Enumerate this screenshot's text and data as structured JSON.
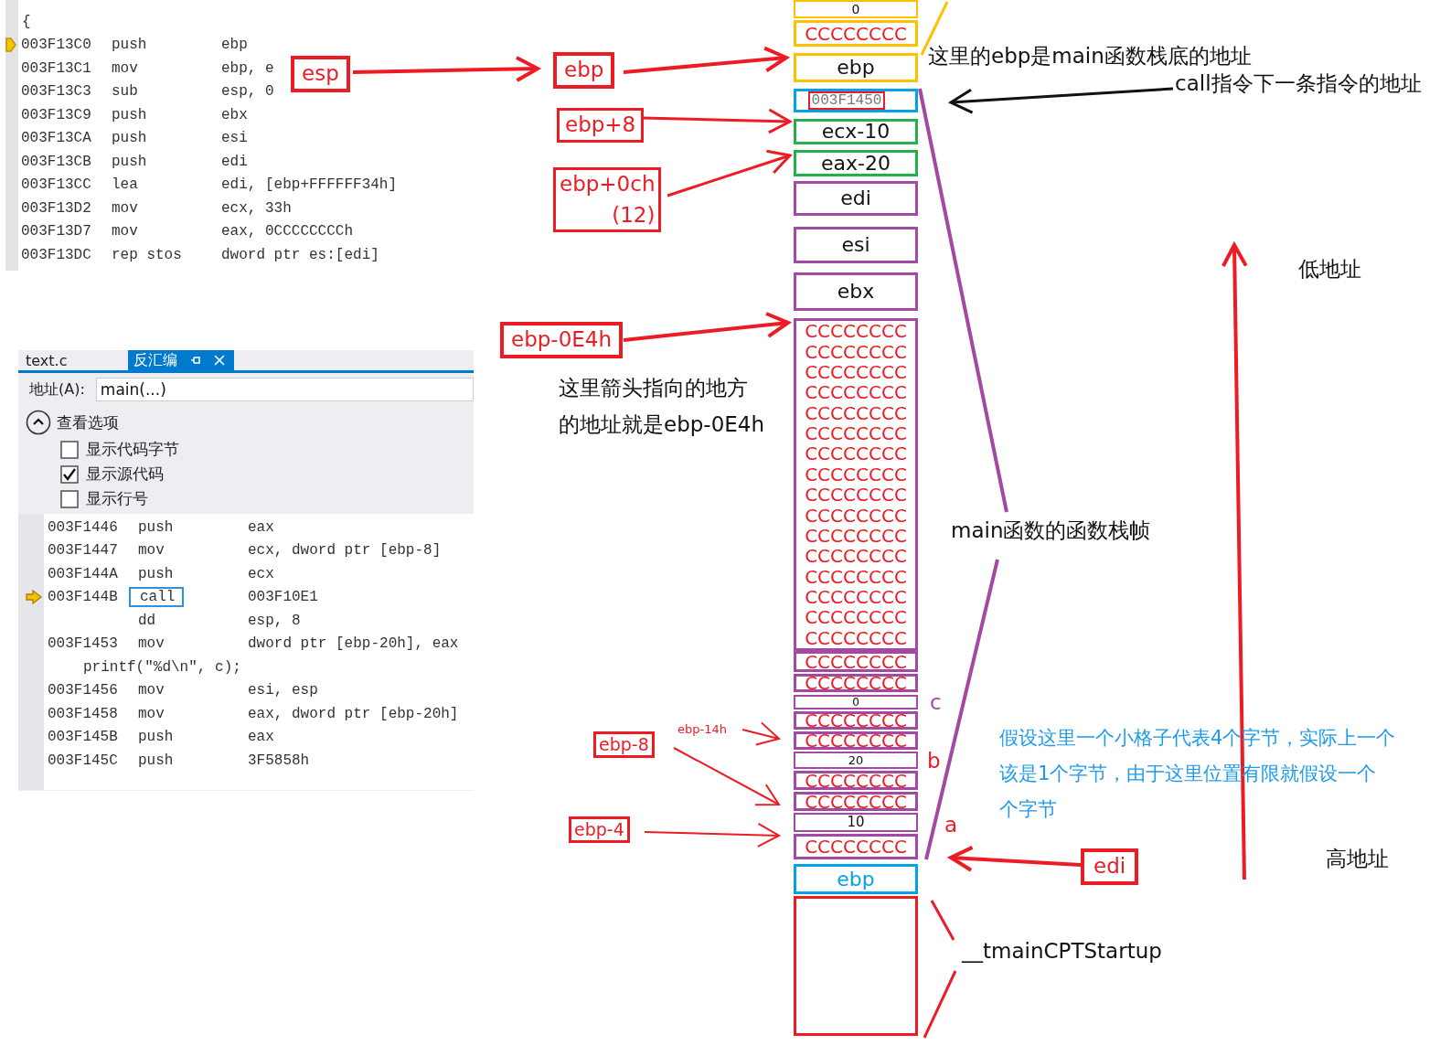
{
  "top_code": {
    "brace": "{",
    "lines": [
      {
        "addr": "003F13C0",
        "op": "push",
        "arg": "ebp",
        "current": true
      },
      {
        "addr": "003F13C1",
        "op": "mov",
        "arg": "ebp, e",
        "current": false
      },
      {
        "addr": "003F13C3",
        "op": "sub",
        "arg": "esp, 0",
        "current": false
      },
      {
        "addr": "003F13C9",
        "op": "push",
        "arg": "ebx",
        "current": false
      },
      {
        "addr": "003F13CA",
        "op": "push",
        "arg": "esi",
        "current": false
      },
      {
        "addr": "003F13CB",
        "op": "push",
        "arg": "edi",
        "current": false
      },
      {
        "addr": "003F13CC",
        "op": "lea",
        "arg": "edi, [ebp+FFFFFF34h]",
        "current": false
      },
      {
        "addr": "003F13D2",
        "op": "mov",
        "arg": "ecx, 33h",
        "current": false
      },
      {
        "addr": "003F13D7",
        "op": "mov",
        "arg": "eax, 0CCCCCCCCh",
        "current": false
      },
      {
        "addr": "003F13DC",
        "op": "rep stos",
        "arg": "dword ptr es:[edi]",
        "current": false
      }
    ]
  },
  "disassembly_panel": {
    "tabs": [
      {
        "label": "text.c",
        "selected": false
      },
      {
        "label": "反汇编",
        "selected": true
      }
    ],
    "address": {
      "label": "地址(A):",
      "value": "main(...)"
    },
    "view_options": {
      "title": "查看选项",
      "expanded": true,
      "options": [
        {
          "label": "显示代码字节",
          "checked": false
        },
        {
          "label": "显示源代码",
          "checked": true
        },
        {
          "label": "显示行号",
          "checked": false
        }
      ]
    },
    "lines": [
      {
        "kind": "instruction",
        "addr": "003F1446",
        "op": "push",
        "arg": "eax",
        "current": false,
        "boxed": false
      },
      {
        "kind": "instruction",
        "addr": "003F1447",
        "op": "mov",
        "arg": "ecx, dword ptr [ebp-8]",
        "current": false,
        "boxed": false
      },
      {
        "kind": "instruction",
        "addr": "003F144A",
        "op": "push",
        "arg": "ecx",
        "current": false,
        "boxed": false
      },
      {
        "kind": "instruction",
        "addr": "003F144B",
        "op": "call",
        "arg": "003F10E1",
        "current": true,
        "boxed": true
      },
      {
        "kind": "instruction",
        "op": "dd",
        "arg": "esp, 8",
        "current": false,
        "boxed": false
      },
      {
        "kind": "instruction",
        "addr": "003F1453",
        "op": "mov",
        "arg": "dword ptr [ebp-20h], eax",
        "current": false,
        "boxed": false
      },
      {
        "kind": "source",
        "text": "printf(\"%d\\n\", c);"
      },
      {
        "kind": "instruction",
        "addr": "003F1456",
        "op": "mov",
        "arg": "esi, esp",
        "current": false,
        "boxed": false
      },
      {
        "kind": "instruction",
        "addr": "003F1458",
        "op": "mov",
        "arg": "eax, dword ptr [ebp-20h]",
        "current": false,
        "boxed": false
      },
      {
        "kind": "instruction",
        "addr": "003F145B",
        "op": "push",
        "arg": "eax",
        "current": false,
        "boxed": false
      },
      {
        "kind": "instruction",
        "addr": "003F145C",
        "op": "push",
        "arg": "3F5858h",
        "current": false,
        "boxed": false
      }
    ]
  },
  "stack": [
    {
      "kind": "value",
      "text": "0",
      "color": "#ffc000"
    },
    {
      "kind": "fill",
      "text": "CCCCCCCC",
      "color": "#ffc000"
    },
    {
      "kind": "value",
      "text": "ebp",
      "color": "#ffc000"
    },
    {
      "kind": "address",
      "text": "003F1450",
      "color": "#00a2e8"
    },
    {
      "kind": "value",
      "text": "ecx-10",
      "color": "#22b14c"
    },
    {
      "kind": "value",
      "text": "eax-20",
      "color": "#22b14c"
    },
    {
      "kind": "value",
      "text": "edi",
      "color": "#a349a4"
    },
    {
      "kind": "value",
      "text": "esi",
      "color": "#a349a4"
    },
    {
      "kind": "value",
      "text": "ebx",
      "color": "#a349a4"
    },
    {
      "kind": "block",
      "color": "#a349a4",
      "lines": [
        "CCCCCCCC",
        "CCCCCCCC",
        "CCCCCCCC",
        "CCCCCCCC",
        "CCCCCCCC",
        "CCCCCCCC",
        "CCCCCCCC",
        "CCCCCCCC",
        "CCCCCCCC",
        "CCCCCCCC",
        "CCCCCCCC",
        "CCCCCCCC",
        "CCCCCCCC",
        "CCCCCCCC",
        "CCCCCCCC",
        "CCCCCCCC"
      ]
    },
    {
      "kind": "fill",
      "text": "CCCCCCCC",
      "color": "#a349a4"
    },
    {
      "kind": "fill",
      "text": "CCCCCCCC",
      "color": "#a349a4"
    },
    {
      "kind": "value",
      "text": "0",
      "color": "#a349a4"
    },
    {
      "kind": "fill",
      "text": "CCCCCCCC",
      "color": "#a349a4"
    },
    {
      "kind": "fill",
      "text": "CCCCCCCC",
      "color": "#a349a4"
    },
    {
      "kind": "value",
      "text": "20",
      "color": "#a349a4"
    },
    {
      "kind": "fill",
      "text": "CCCCCCCC",
      "color": "#a349a4"
    },
    {
      "kind": "fill",
      "text": "CCCCCCCC",
      "color": "#a349a4"
    },
    {
      "kind": "value",
      "text": "10",
      "color": "#a349a4"
    },
    {
      "kind": "fill",
      "text": "CCCCCCCC",
      "color": "#a349a4"
    },
    {
      "kind": "frame",
      "text": "ebp",
      "color": "#00a2e8"
    },
    {
      "kind": "empty",
      "color": "#ed1c24"
    }
  ],
  "annotations": {
    "esp_box": "esp",
    "ebp_box": "ebp",
    "ebp_plus_8": "ebp+8",
    "ebp_plus_0ch": [
      "ebp+0ch",
      "(12)"
    ],
    "ebp_minus_0e4h": "ebp-0E4h",
    "pointer_note": [
      "这里箭头指向的地方",
      "的地址就是ebp-0E4h"
    ],
    "ebp_note": "这里的ebp是main函数栈底的地址",
    "return_address_note": "call指令下一条指令的地址",
    "low_address": "低地址",
    "frame_note": "main函数的函数栈帧",
    "var_c": "c",
    "var_b": "b",
    "var_a": "a",
    "ebp_minus_14h": "ebp-14h",
    "ebp_minus_8": "ebp-8",
    "ebp_minus_4": "ebp-4",
    "edi_box": "edi",
    "size_note": [
      "假设这里一个小格子代表4个字节，实际上一个",
      "该是1个字节，由于这里位置有限就假设一个",
      "个字节"
    ],
    "high_address": "高地址",
    "startup_label": "__tmainCPTStartup"
  }
}
